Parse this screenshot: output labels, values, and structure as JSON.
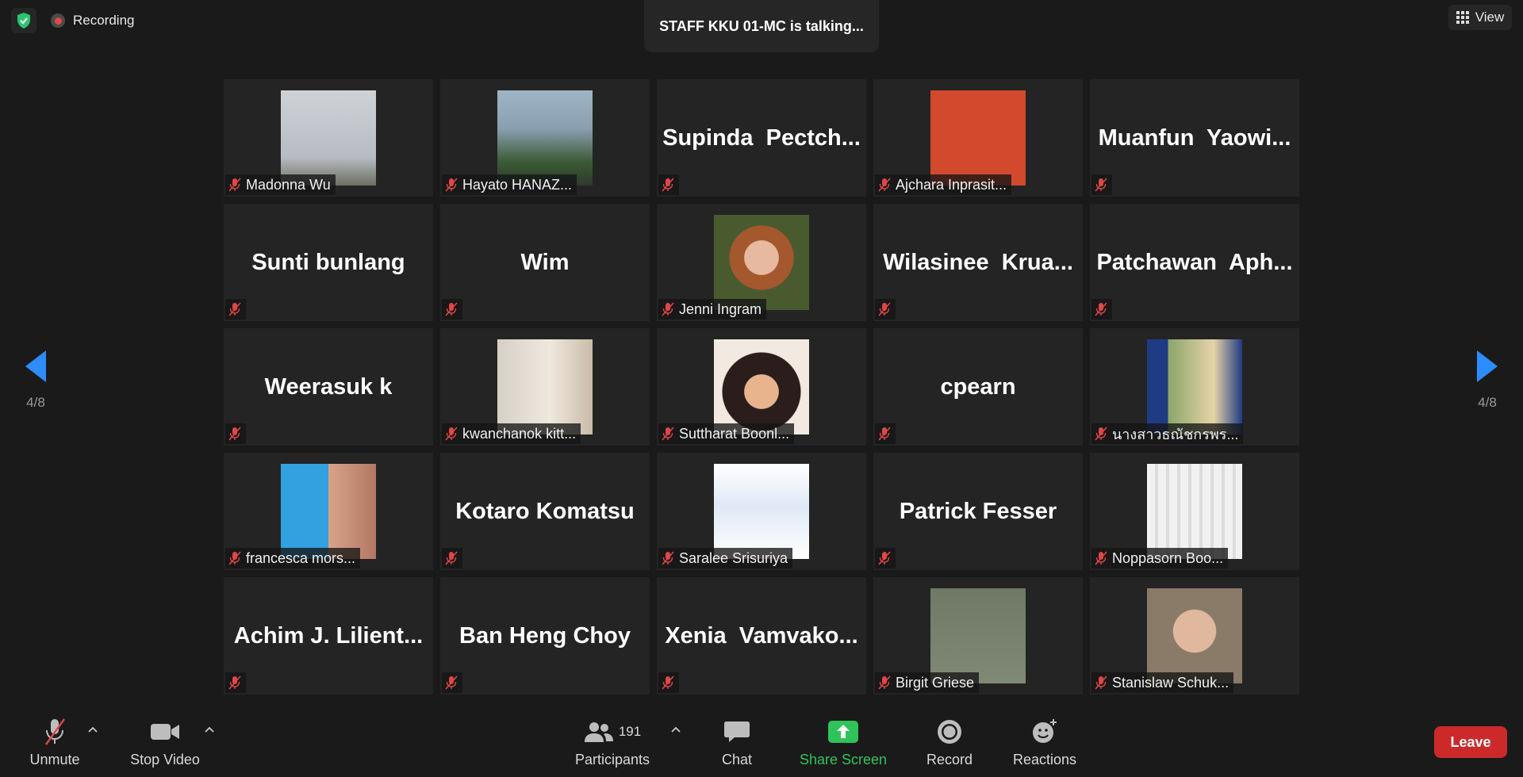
{
  "topbar": {
    "recording_label": "Recording",
    "talking_text": "STAFF KKU 01-MC is talking...",
    "view_label": "View"
  },
  "nav": {
    "page_left": "4/8",
    "page_right": "4/8"
  },
  "colors": {
    "accent_blue": "#2d8cff",
    "green": "#2fc35a",
    "leave_red": "#cc2a2a",
    "muted_red": "#e04747"
  },
  "participants": [
    {
      "tile_name": "",
      "label": "Madonna Wu",
      "photo": "photo-jumping-person"
    },
    {
      "tile_name": "",
      "label": "Hayato HANAZ...",
      "photo": "photo-statue"
    },
    {
      "tile_name": "Supinda  Pectch...",
      "label": "",
      "photo": ""
    },
    {
      "tile_name": "",
      "label": "Ajchara Inprasit...",
      "photo": "photo-university-logo"
    },
    {
      "tile_name": "Muanfun  Yaowi...",
      "label": "",
      "photo": ""
    },
    {
      "tile_name": "Sunti bunlang",
      "label": "",
      "photo": ""
    },
    {
      "tile_name": "Wim",
      "label": "",
      "photo": ""
    },
    {
      "tile_name": "",
      "label": "Jenni Ingram",
      "photo": "photo-woman-red-hair"
    },
    {
      "tile_name": "Wilasinee  Krua...",
      "label": "",
      "photo": ""
    },
    {
      "tile_name": "Patchawan  Aph...",
      "label": "",
      "photo": ""
    },
    {
      "tile_name": "Weerasuk k",
      "label": "",
      "photo": ""
    },
    {
      "tile_name": "",
      "label": "kwanchanok kitt...",
      "photo": "photo-woman-sitting"
    },
    {
      "tile_name": "",
      "label": "Suttharat Boonl...",
      "photo": "photo-cartoon-woman"
    },
    {
      "tile_name": "cpearn",
      "label": "",
      "photo": ""
    },
    {
      "tile_name": "",
      "label": "นางสาวธณัชกรพร...",
      "photo": "photo-woman-outdoor"
    },
    {
      "tile_name": "",
      "label": "francesca mors...",
      "photo": "photo-woman-glasses"
    },
    {
      "tile_name": "Kotaro Komatsu",
      "label": "",
      "photo": ""
    },
    {
      "tile_name": "",
      "label": "Saralee Srisuriya",
      "photo": "photo-pme44-poster"
    },
    {
      "tile_name": "Patrick Fesser",
      "label": "",
      "photo": ""
    },
    {
      "tile_name": "",
      "label": "Noppasorn Boo...",
      "photo": "photo-woman-smiling"
    },
    {
      "tile_name": "Achim J. Lilient...",
      "label": "",
      "photo": ""
    },
    {
      "tile_name": "Ban Heng Choy",
      "label": "",
      "photo": ""
    },
    {
      "tile_name": "Xenia  Vamvako...",
      "label": "",
      "photo": ""
    },
    {
      "tile_name": "",
      "label": "Birgit Griese",
      "photo": "photo-woman-chalkboard"
    },
    {
      "tile_name": "",
      "label": "Stanislaw Schuk...",
      "photo": "photo-man-glasses"
    }
  ],
  "toolbar": {
    "unmute_label": "Unmute",
    "stop_video_label": "Stop Video",
    "participants_label": "Participants",
    "participants_count": "191",
    "chat_label": "Chat",
    "share_screen_label": "Share Screen",
    "record_label": "Record",
    "reactions_label": "Reactions",
    "leave_label": "Leave"
  }
}
